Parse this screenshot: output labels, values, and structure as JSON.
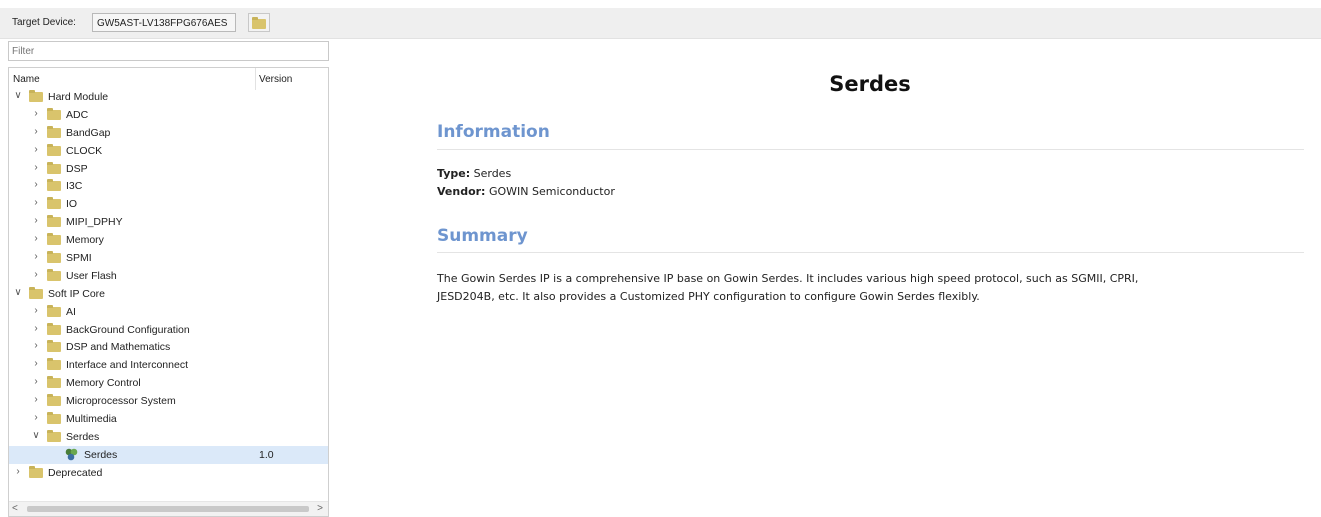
{
  "toolbar": {
    "target_label": "Target Device:",
    "device_value": "GW5AST-LV138FPG676AES",
    "folder_icon": "folder-icon"
  },
  "filter": {
    "placeholder": "Filter"
  },
  "tree": {
    "columns": {
      "name": "Name",
      "version": "Version"
    },
    "rows": [
      {
        "label": "Hard Module",
        "level": 0,
        "expanded": true
      },
      {
        "label": "ADC",
        "level": 1,
        "expanded": false
      },
      {
        "label": "BandGap",
        "level": 1,
        "expanded": false
      },
      {
        "label": "CLOCK",
        "level": 1,
        "expanded": false
      },
      {
        "label": "DSP",
        "level": 1,
        "expanded": false
      },
      {
        "label": "I3C",
        "level": 1,
        "expanded": false
      },
      {
        "label": "IO",
        "level": 1,
        "expanded": false
      },
      {
        "label": "MIPI_DPHY",
        "level": 1,
        "expanded": false
      },
      {
        "label": "Memory",
        "level": 1,
        "expanded": false
      },
      {
        "label": "SPMI",
        "level": 1,
        "expanded": false
      },
      {
        "label": "User Flash",
        "level": 1,
        "expanded": false
      },
      {
        "label": "Soft IP Core",
        "level": 0,
        "expanded": true
      },
      {
        "label": "AI",
        "level": 1,
        "expanded": false
      },
      {
        "label": "BackGround Configuration",
        "level": 1,
        "expanded": false
      },
      {
        "label": "DSP and Mathematics",
        "level": 1,
        "expanded": false
      },
      {
        "label": "Interface and Interconnect",
        "level": 1,
        "expanded": false
      },
      {
        "label": "Memory Control",
        "level": 1,
        "expanded": false
      },
      {
        "label": "Microprocessor System",
        "level": 1,
        "expanded": false
      },
      {
        "label": "Multimedia",
        "level": 1,
        "expanded": false
      },
      {
        "label": "Serdes",
        "level": 1,
        "expanded": true
      },
      {
        "label": "Serdes",
        "level": 2,
        "leaf": true,
        "version": "1.0",
        "selected": true
      },
      {
        "label": "Deprecated",
        "level": 0,
        "expanded": false
      }
    ]
  },
  "scrollbar": {
    "left_arrow": "<",
    "right_arrow": ">"
  },
  "detail": {
    "title": "Serdes",
    "info_heading": "Information",
    "type_label": "Type:",
    "type_value": "Serdes",
    "vendor_label": "Vendor:",
    "vendor_value": "GOWIN Semiconductor",
    "summary_heading": "Summary",
    "summary_line1": "The Gowin Serdes IP is a comprehensive IP base on Gowin Serdes. It includes various high speed protocol, such as SGMII, CPRI,",
    "summary_line2": "JESD204B, etc. It also provides a Customized PHY configuration to configure Gowin Serdes flexibly."
  },
  "colors": {
    "accent_heading": "#6e95cf",
    "selection": "#dbe9f9",
    "folder": "#d9c46c"
  }
}
